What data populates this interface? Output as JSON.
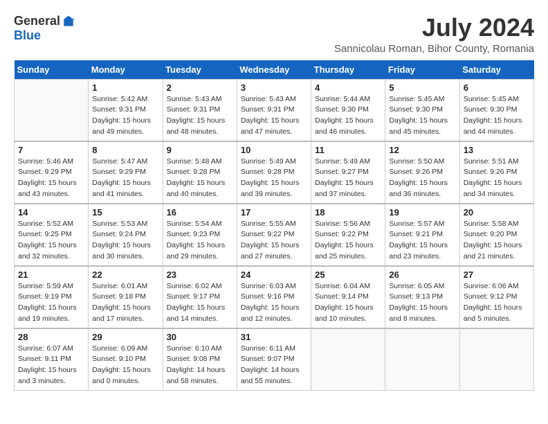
{
  "logo": {
    "general": "General",
    "blue": "Blue"
  },
  "header": {
    "month": "July 2024",
    "location": "Sannicolau Roman, Bihor County, Romania"
  },
  "weekdays": [
    "Sunday",
    "Monday",
    "Tuesday",
    "Wednesday",
    "Thursday",
    "Friday",
    "Saturday"
  ],
  "weeks": [
    [
      {
        "day": "",
        "sunrise": "",
        "sunset": "",
        "daylight": ""
      },
      {
        "day": "1",
        "sunrise": "Sunrise: 5:42 AM",
        "sunset": "Sunset: 9:31 PM",
        "daylight": "Daylight: 15 hours and 49 minutes."
      },
      {
        "day": "2",
        "sunrise": "Sunrise: 5:43 AM",
        "sunset": "Sunset: 9:31 PM",
        "daylight": "Daylight: 15 hours and 48 minutes."
      },
      {
        "day": "3",
        "sunrise": "Sunrise: 5:43 AM",
        "sunset": "Sunset: 9:31 PM",
        "daylight": "Daylight: 15 hours and 47 minutes."
      },
      {
        "day": "4",
        "sunrise": "Sunrise: 5:44 AM",
        "sunset": "Sunset: 9:30 PM",
        "daylight": "Daylight: 15 hours and 46 minutes."
      },
      {
        "day": "5",
        "sunrise": "Sunrise: 5:45 AM",
        "sunset": "Sunset: 9:30 PM",
        "daylight": "Daylight: 15 hours and 45 minutes."
      },
      {
        "day": "6",
        "sunrise": "Sunrise: 5:45 AM",
        "sunset": "Sunset: 9:30 PM",
        "daylight": "Daylight: 15 hours and 44 minutes."
      }
    ],
    [
      {
        "day": "7",
        "sunrise": "Sunrise: 5:46 AM",
        "sunset": "Sunset: 9:29 PM",
        "daylight": "Daylight: 15 hours and 43 minutes."
      },
      {
        "day": "8",
        "sunrise": "Sunrise: 5:47 AM",
        "sunset": "Sunset: 9:29 PM",
        "daylight": "Daylight: 15 hours and 41 minutes."
      },
      {
        "day": "9",
        "sunrise": "Sunrise: 5:48 AM",
        "sunset": "Sunset: 9:28 PM",
        "daylight": "Daylight: 15 hours and 40 minutes."
      },
      {
        "day": "10",
        "sunrise": "Sunrise: 5:49 AM",
        "sunset": "Sunset: 9:28 PM",
        "daylight": "Daylight: 15 hours and 39 minutes."
      },
      {
        "day": "11",
        "sunrise": "Sunrise: 5:49 AM",
        "sunset": "Sunset: 9:27 PM",
        "daylight": "Daylight: 15 hours and 37 minutes."
      },
      {
        "day": "12",
        "sunrise": "Sunrise: 5:50 AM",
        "sunset": "Sunset: 9:26 PM",
        "daylight": "Daylight: 15 hours and 36 minutes."
      },
      {
        "day": "13",
        "sunrise": "Sunrise: 5:51 AM",
        "sunset": "Sunset: 9:26 PM",
        "daylight": "Daylight: 15 hours and 34 minutes."
      }
    ],
    [
      {
        "day": "14",
        "sunrise": "Sunrise: 5:52 AM",
        "sunset": "Sunset: 9:25 PM",
        "daylight": "Daylight: 15 hours and 32 minutes."
      },
      {
        "day": "15",
        "sunrise": "Sunrise: 5:53 AM",
        "sunset": "Sunset: 9:24 PM",
        "daylight": "Daylight: 15 hours and 30 minutes."
      },
      {
        "day": "16",
        "sunrise": "Sunrise: 5:54 AM",
        "sunset": "Sunset: 9:23 PM",
        "daylight": "Daylight: 15 hours and 29 minutes."
      },
      {
        "day": "17",
        "sunrise": "Sunrise: 5:55 AM",
        "sunset": "Sunset: 9:22 PM",
        "daylight": "Daylight: 15 hours and 27 minutes."
      },
      {
        "day": "18",
        "sunrise": "Sunrise: 5:56 AM",
        "sunset": "Sunset: 9:22 PM",
        "daylight": "Daylight: 15 hours and 25 minutes."
      },
      {
        "day": "19",
        "sunrise": "Sunrise: 5:57 AM",
        "sunset": "Sunset: 9:21 PM",
        "daylight": "Daylight: 15 hours and 23 minutes."
      },
      {
        "day": "20",
        "sunrise": "Sunrise: 5:58 AM",
        "sunset": "Sunset: 9:20 PM",
        "daylight": "Daylight: 15 hours and 21 minutes."
      }
    ],
    [
      {
        "day": "21",
        "sunrise": "Sunrise: 5:59 AM",
        "sunset": "Sunset: 9:19 PM",
        "daylight": "Daylight: 15 hours and 19 minutes."
      },
      {
        "day": "22",
        "sunrise": "Sunrise: 6:01 AM",
        "sunset": "Sunset: 9:18 PM",
        "daylight": "Daylight: 15 hours and 17 minutes."
      },
      {
        "day": "23",
        "sunrise": "Sunrise: 6:02 AM",
        "sunset": "Sunset: 9:17 PM",
        "daylight": "Daylight: 15 hours and 14 minutes."
      },
      {
        "day": "24",
        "sunrise": "Sunrise: 6:03 AM",
        "sunset": "Sunset: 9:16 PM",
        "daylight": "Daylight: 15 hours and 12 minutes."
      },
      {
        "day": "25",
        "sunrise": "Sunrise: 6:04 AM",
        "sunset": "Sunset: 9:14 PM",
        "daylight": "Daylight: 15 hours and 10 minutes."
      },
      {
        "day": "26",
        "sunrise": "Sunrise: 6:05 AM",
        "sunset": "Sunset: 9:13 PM",
        "daylight": "Daylight: 15 hours and 8 minutes."
      },
      {
        "day": "27",
        "sunrise": "Sunrise: 6:06 AM",
        "sunset": "Sunset: 9:12 PM",
        "daylight": "Daylight: 15 hours and 5 minutes."
      }
    ],
    [
      {
        "day": "28",
        "sunrise": "Sunrise: 6:07 AM",
        "sunset": "Sunset: 9:11 PM",
        "daylight": "Daylight: 15 hours and 3 minutes."
      },
      {
        "day": "29",
        "sunrise": "Sunrise: 6:09 AM",
        "sunset": "Sunset: 9:10 PM",
        "daylight": "Daylight: 15 hours and 0 minutes."
      },
      {
        "day": "30",
        "sunrise": "Sunrise: 6:10 AM",
        "sunset": "Sunset: 9:08 PM",
        "daylight": "Daylight: 14 hours and 58 minutes."
      },
      {
        "day": "31",
        "sunrise": "Sunrise: 6:11 AM",
        "sunset": "Sunset: 9:07 PM",
        "daylight": "Daylight: 14 hours and 55 minutes."
      },
      {
        "day": "",
        "sunrise": "",
        "sunset": "",
        "daylight": ""
      },
      {
        "day": "",
        "sunrise": "",
        "sunset": "",
        "daylight": ""
      },
      {
        "day": "",
        "sunrise": "",
        "sunset": "",
        "daylight": ""
      }
    ]
  ]
}
